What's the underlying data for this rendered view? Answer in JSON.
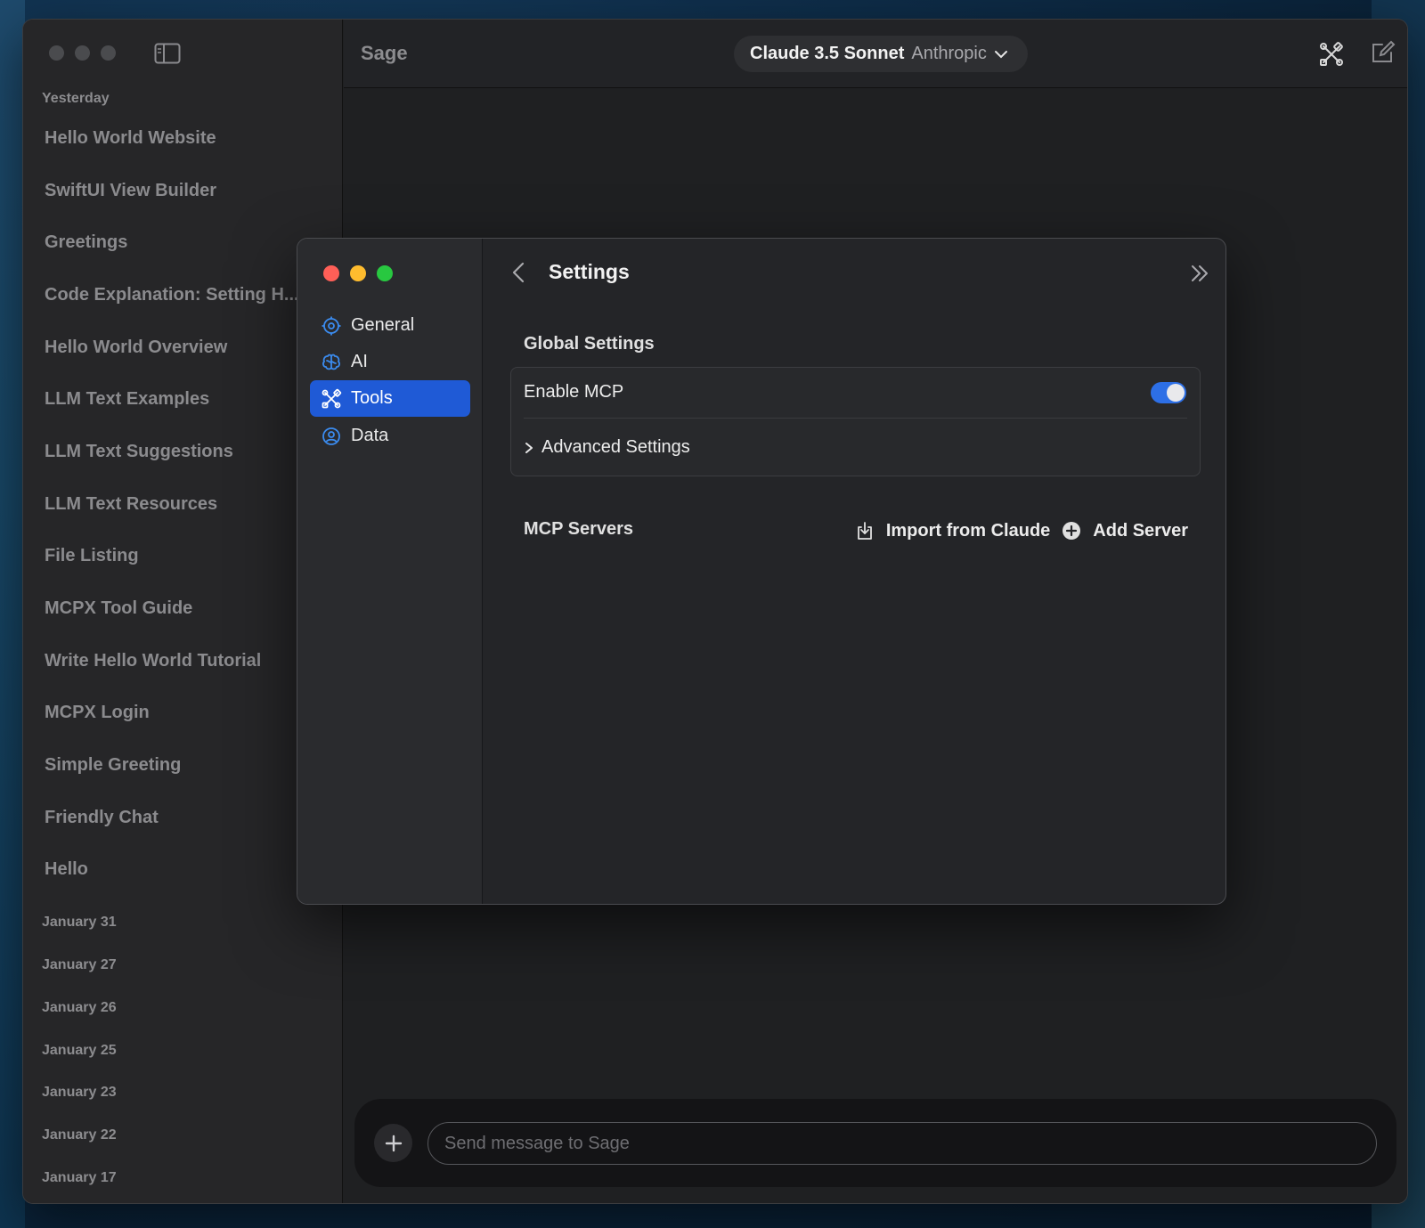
{
  "main": {
    "app_title": "Sage",
    "model": {
      "name": "Claude 3.5 Sonnet",
      "provider": "Anthropic"
    },
    "composer_placeholder": "Send message to Sage"
  },
  "sidebar": {
    "group_label": "Yesterday",
    "conversations": [
      "Hello World Website",
      "SwiftUI View Builder",
      "Greetings",
      "Code Explanation: Setting H...",
      "Hello World Overview",
      "LLM Text Examples",
      "LLM Text Suggestions",
      "LLM Text Resources",
      "File Listing",
      "MCPX Tool Guide",
      "Write Hello World Tutorial",
      "MCPX Login",
      "Simple Greeting",
      "Friendly Chat",
      "Hello"
    ],
    "date_groups": [
      "January 31",
      "January 27",
      "January 26",
      "January 25",
      "January 23",
      "January 22",
      "January 17"
    ]
  },
  "settings": {
    "title": "Settings",
    "nav": [
      {
        "label": "General",
        "icon": "gear-icon"
      },
      {
        "label": "AI",
        "icon": "brain-icon"
      },
      {
        "label": "Tools",
        "icon": "tools-icon",
        "active": true
      },
      {
        "label": "Data",
        "icon": "user-circle-icon"
      }
    ],
    "global_settings_label": "Global Settings",
    "enable_mcp_label": "Enable MCP",
    "enable_mcp_on": true,
    "advanced_settings_label": "Advanced Settings",
    "mcp_servers_label": "MCP Servers",
    "import_label": "Import from Claude",
    "add_server_label": "Add Server"
  },
  "colors": {
    "accent": "#1f5ad6",
    "toggle_on": "#2d6fe6",
    "close": "#ff5f57",
    "minimize": "#febc2e",
    "zoom": "#28c840"
  }
}
